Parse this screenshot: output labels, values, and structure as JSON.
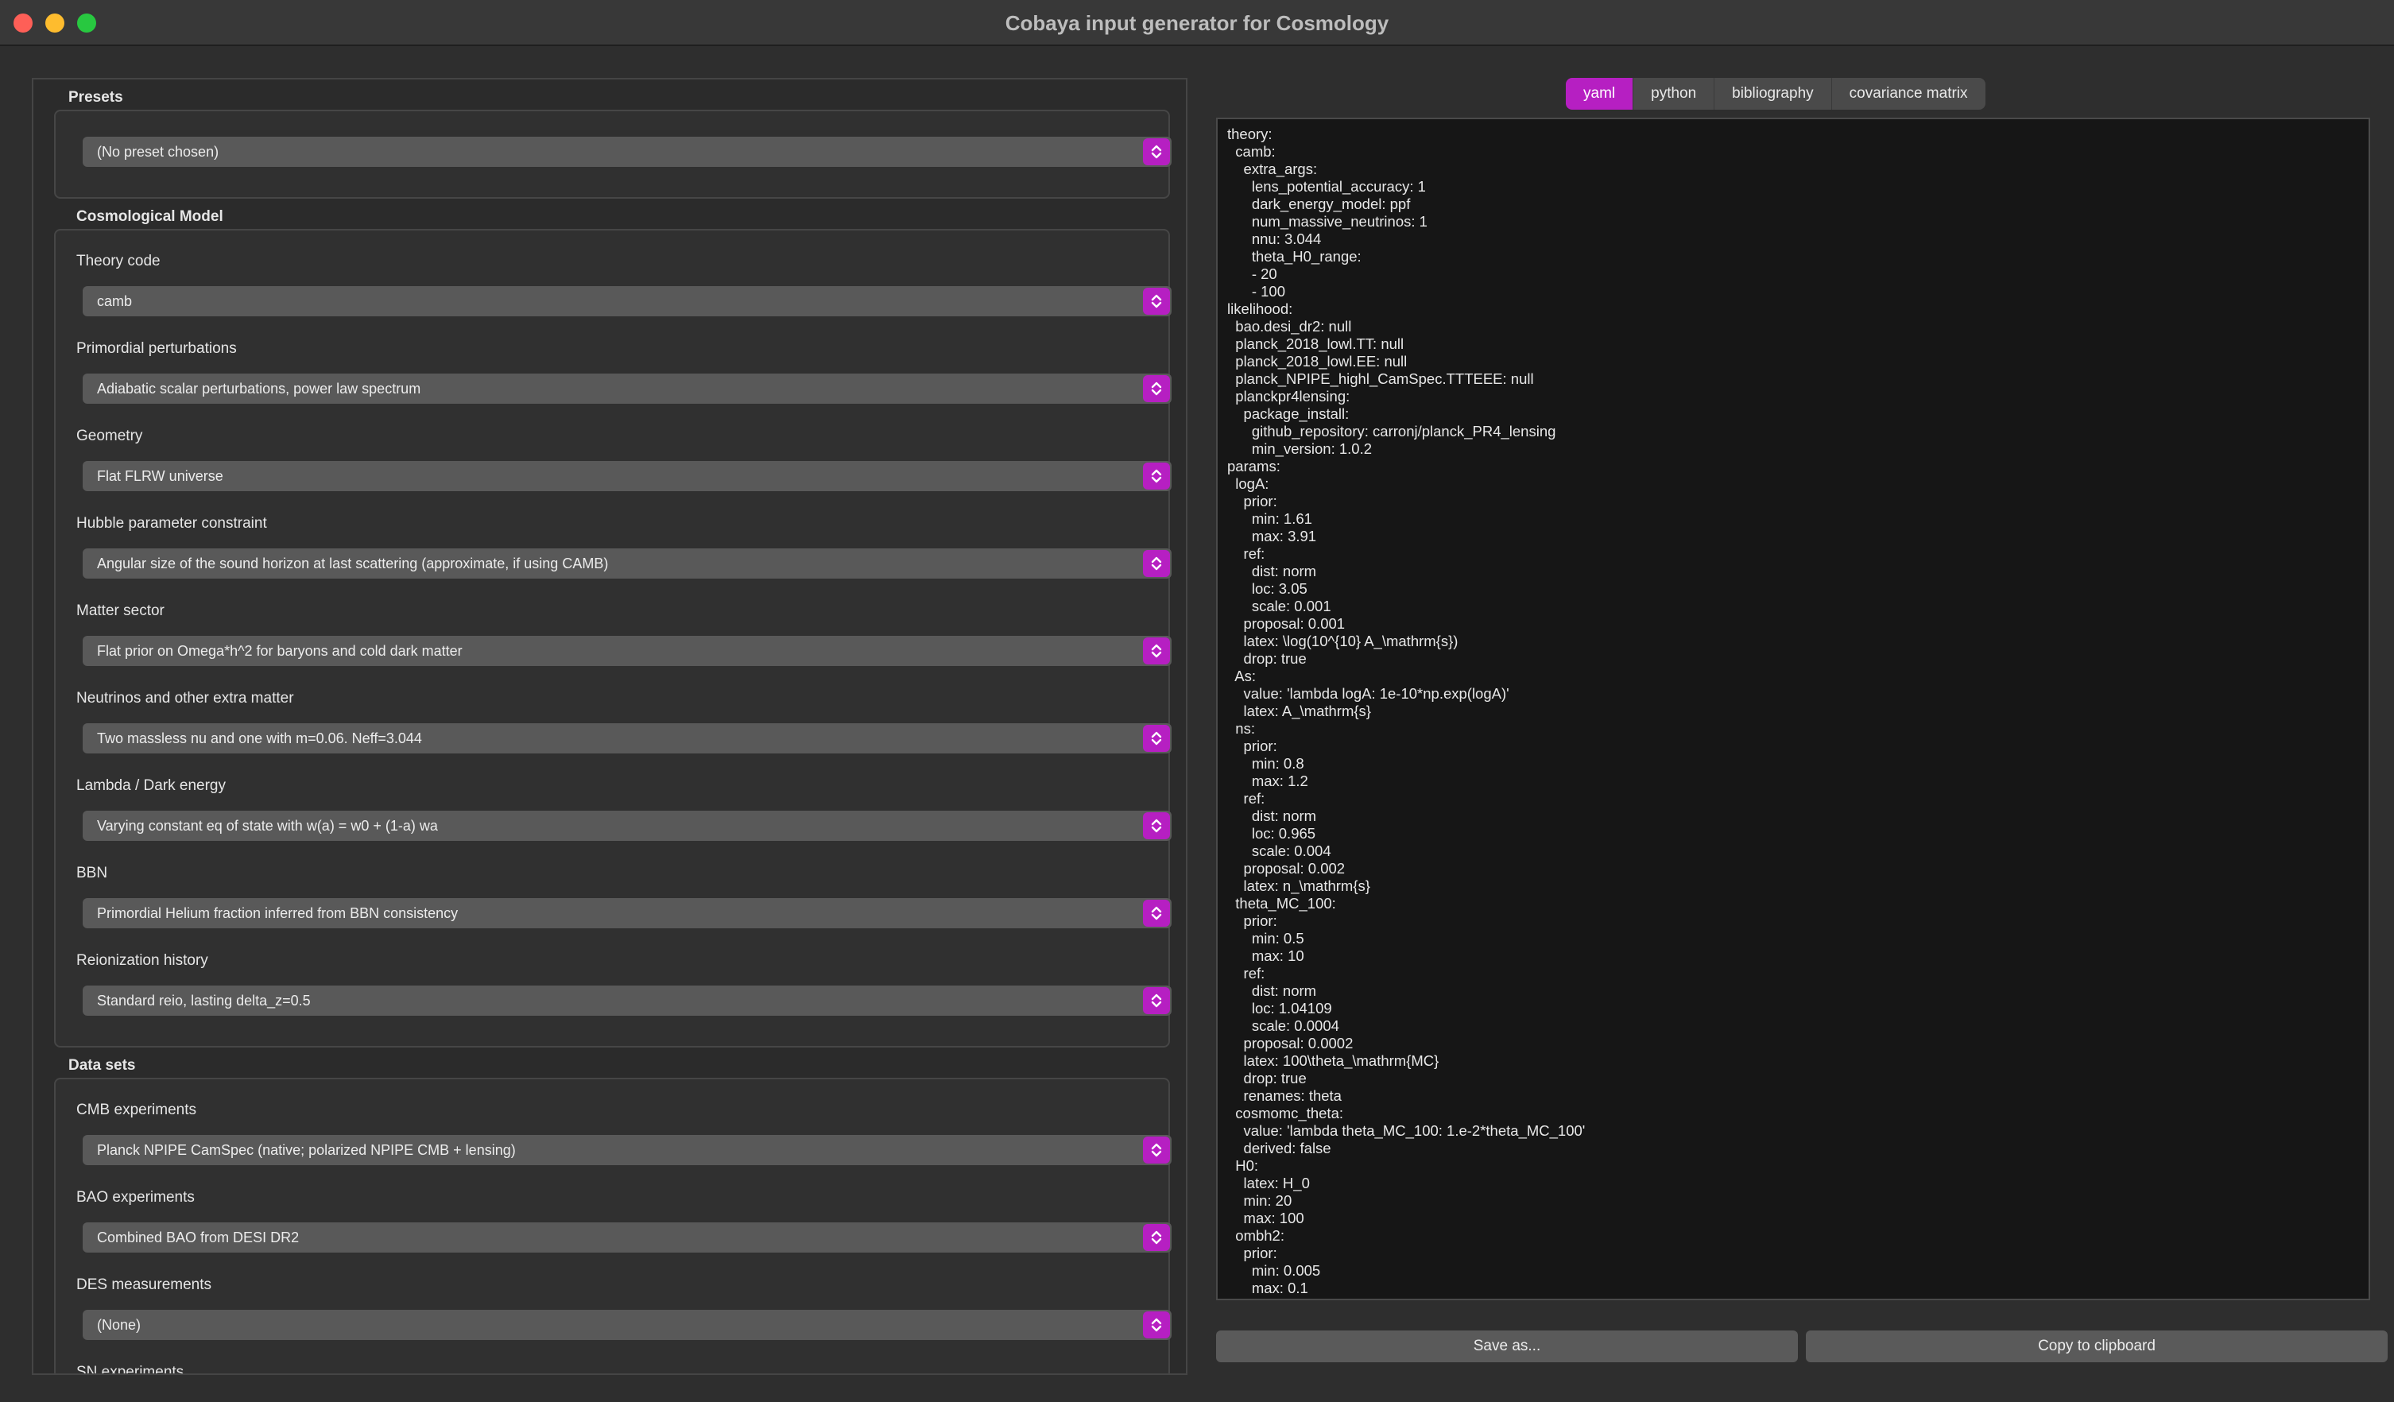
{
  "window": {
    "title": "Cobaya input generator for Cosmology"
  },
  "presets": {
    "label": "Presets",
    "value": "(No preset chosen)"
  },
  "cosmological_model": {
    "label": "Cosmological Model",
    "fields": [
      {
        "label": "Theory code",
        "value": "camb"
      },
      {
        "label": "Primordial perturbations",
        "value": "Adiabatic scalar perturbations, power law spectrum"
      },
      {
        "label": "Geometry",
        "value": "Flat FLRW universe"
      },
      {
        "label": "Hubble parameter constraint",
        "value": "Angular size of the sound horizon at last scattering (approximate, if using CAMB)"
      },
      {
        "label": "Matter sector",
        "value": "Flat prior on Omega*h^2 for baryons and cold dark matter"
      },
      {
        "label": "Neutrinos and other extra matter",
        "value": "Two massless nu and one with m=0.06. Neff=3.044"
      },
      {
        "label": "Lambda / Dark energy",
        "value": "Varying constant eq of state with w(a) = w0 + (1-a) wa"
      },
      {
        "label": "BBN",
        "value": "Primordial Helium fraction inferred from BBN consistency"
      },
      {
        "label": "Reionization history",
        "value": "Standard reio, lasting delta_z=0.5"
      }
    ]
  },
  "data_sets": {
    "label": "Data sets",
    "fields": [
      {
        "label": "CMB experiments",
        "value": "Planck NPIPE CamSpec (native; polarized NPIPE CMB + lensing)"
      },
      {
        "label": "BAO experiments",
        "value": "Combined BAO from DESI DR2"
      },
      {
        "label": "DES measurements",
        "value": "(None)"
      },
      {
        "label": "SN experiments",
        "value": ""
      }
    ]
  },
  "tabs": [
    "yaml",
    "python",
    "bibliography",
    "covariance matrix"
  ],
  "active_tab": "yaml",
  "yaml_text": "theory:\n  camb:\n    extra_args:\n      lens_potential_accuracy: 1\n      dark_energy_model: ppf\n      num_massive_neutrinos: 1\n      nnu: 3.044\n      theta_H0_range:\n      - 20\n      - 100\nlikelihood:\n  bao.desi_dr2: null\n  planck_2018_lowl.TT: null\n  planck_2018_lowl.EE: null\n  planck_NPIPE_highl_CamSpec.TTTEEE: null\n  planckpr4lensing:\n    package_install:\n      github_repository: carronj/planck_PR4_lensing\n      min_version: 1.0.2\nparams:\n  logA:\n    prior:\n      min: 1.61\n      max: 3.91\n    ref:\n      dist: norm\n      loc: 3.05\n      scale: 0.001\n    proposal: 0.001\n    latex: \\log(10^{10} A_\\mathrm{s})\n    drop: true\n  As:\n    value: 'lambda logA: 1e-10*np.exp(logA)'\n    latex: A_\\mathrm{s}\n  ns:\n    prior:\n      min: 0.8\n      max: 1.2\n    ref:\n      dist: norm\n      loc: 0.965\n      scale: 0.004\n    proposal: 0.002\n    latex: n_\\mathrm{s}\n  theta_MC_100:\n    prior:\n      min: 0.5\n      max: 10\n    ref:\n      dist: norm\n      loc: 1.04109\n      scale: 0.0004\n    proposal: 0.0002\n    latex: 100\\theta_\\mathrm{MC}\n    drop: true\n    renames: theta\n  cosmomc_theta:\n    value: 'lambda theta_MC_100: 1.e-2*theta_MC_100'\n    derived: false\n  H0:\n    latex: H_0\n    min: 20\n    max: 100\n  ombh2:\n    prior:\n      min: 0.005\n      max: 0.1",
  "buttons": {
    "save": "Save as...",
    "copy": "Copy to clipboard"
  },
  "colors": {
    "accent": "#b61fc2",
    "close": "#fe5f57",
    "minimize": "#febc2e",
    "maximize": "#28c840"
  }
}
